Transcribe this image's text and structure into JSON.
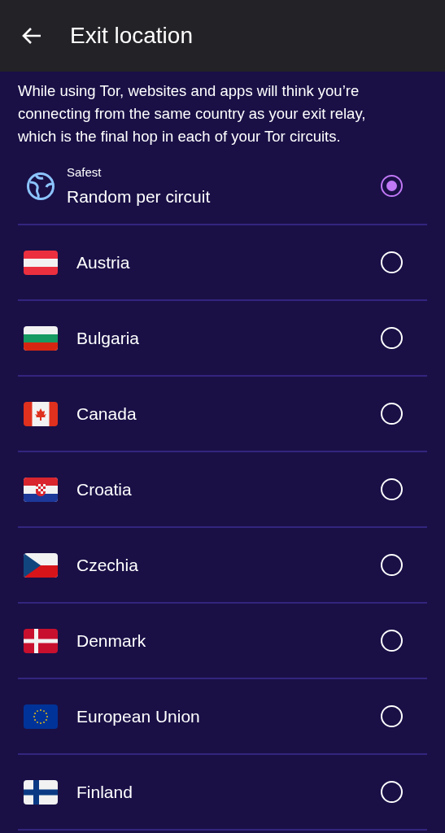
{
  "app_bar": {
    "title": "Exit location"
  },
  "description": "While using Tor, websites and apps will think you’re connecting from the same country as your exit relay, which is the final hop in each of your Tor circuits.",
  "options": [
    {
      "kind": "random",
      "overline": "Safest",
      "label": "Random per circuit",
      "selected": true
    },
    {
      "kind": "country",
      "label": "Austria",
      "selected": false
    },
    {
      "kind": "country",
      "label": "Bulgaria",
      "selected": false
    },
    {
      "kind": "country",
      "label": "Canada",
      "selected": false
    },
    {
      "kind": "country",
      "label": "Croatia",
      "selected": false
    },
    {
      "kind": "country",
      "label": "Czechia",
      "selected": false
    },
    {
      "kind": "country",
      "label": "Denmark",
      "selected": false
    },
    {
      "kind": "country",
      "label": "European Union",
      "selected": false
    },
    {
      "kind": "country",
      "label": "Finland",
      "selected": false
    }
  ]
}
